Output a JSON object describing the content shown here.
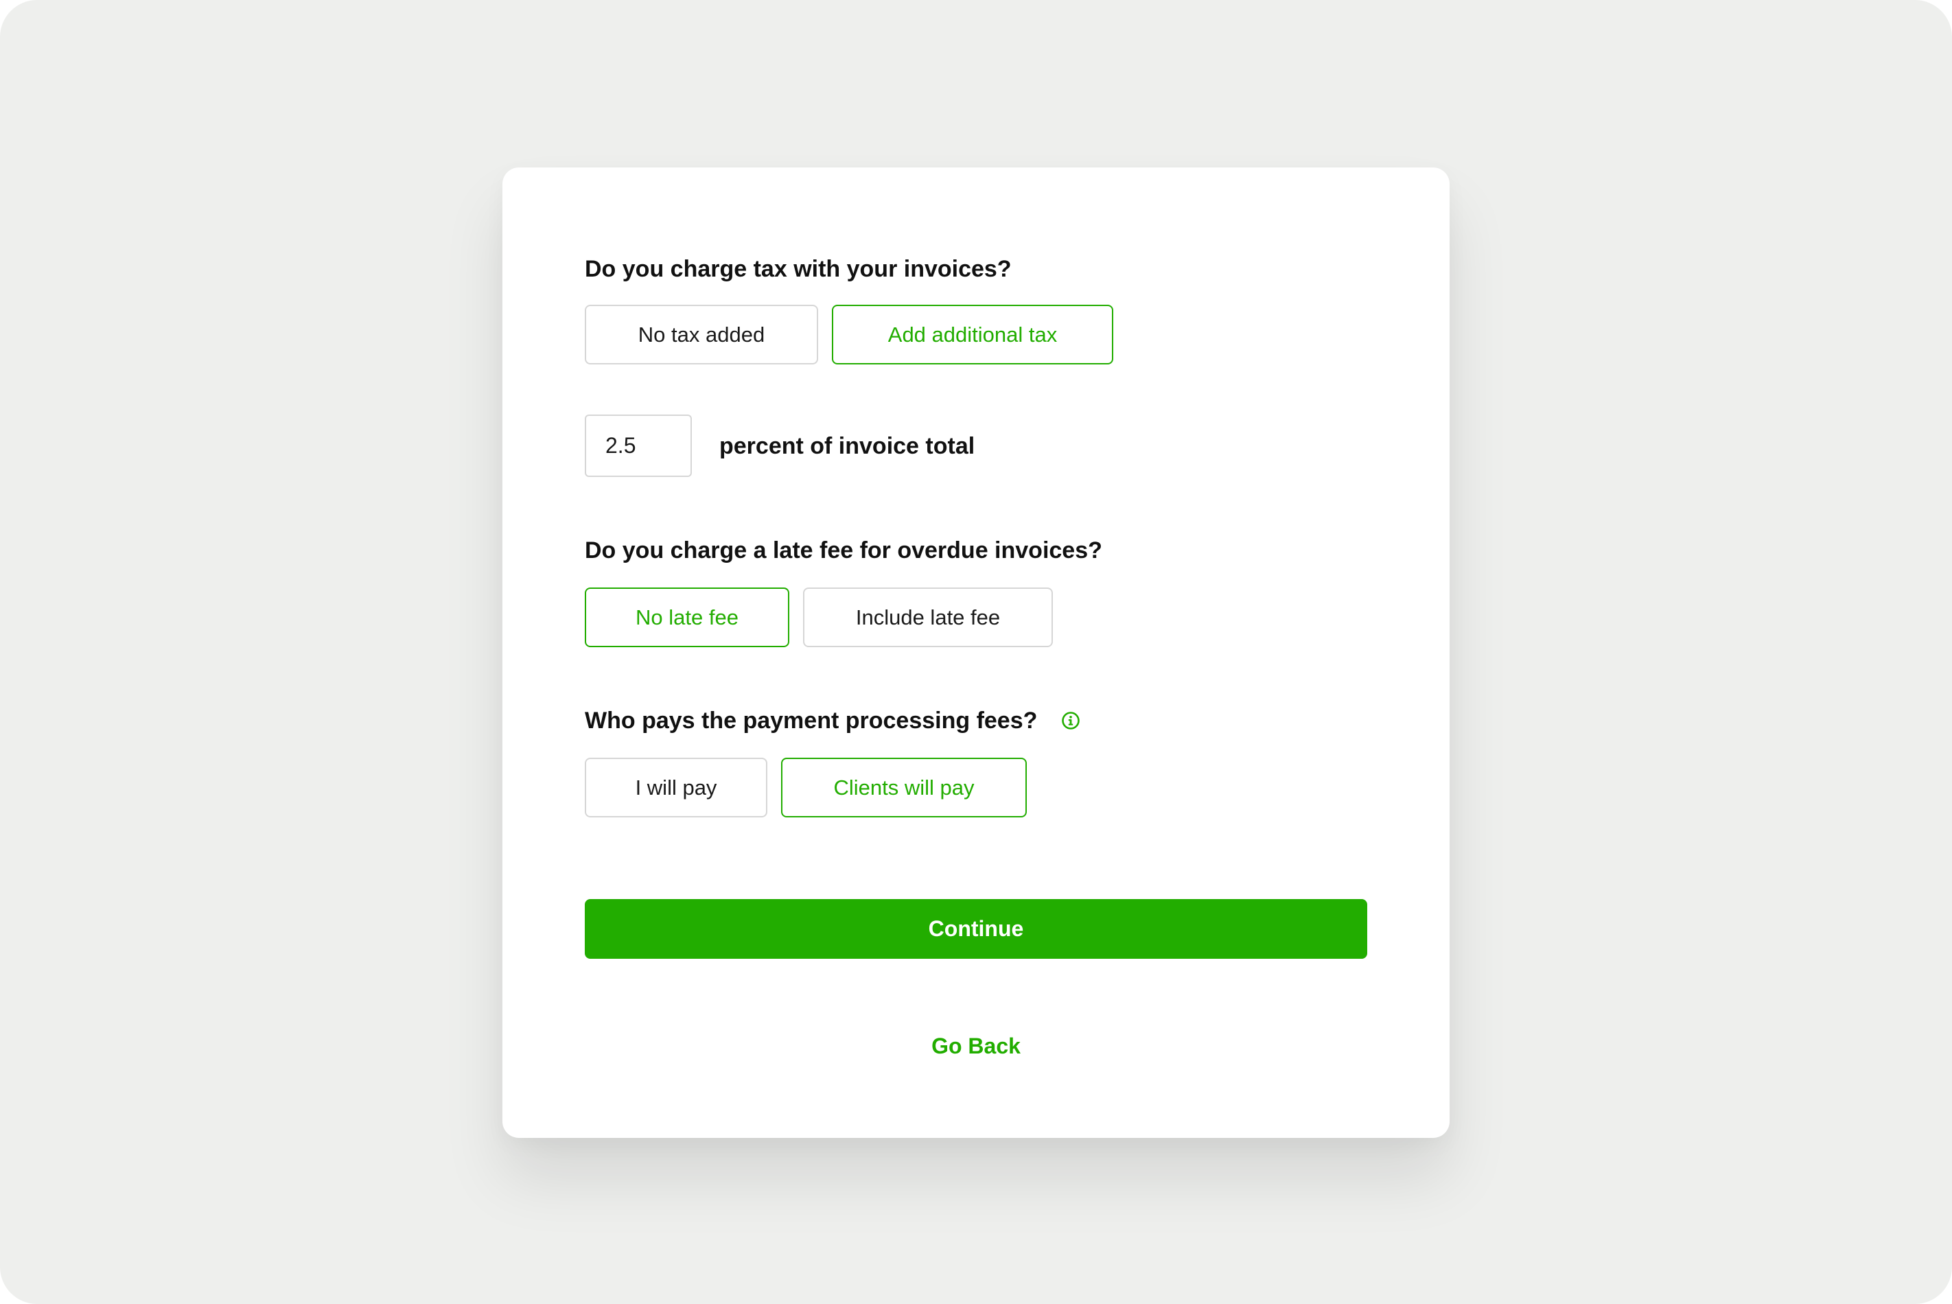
{
  "tax": {
    "question": "Do you charge tax with your invoices?",
    "options": [
      {
        "label": "No tax added",
        "selected": false
      },
      {
        "label": "Add additional tax",
        "selected": true
      }
    ],
    "percent_value": "2.5",
    "percent_label": "percent of invoice total"
  },
  "late_fee": {
    "question": "Do you charge a late fee for overdue invoices?",
    "options": [
      {
        "label": "No late fee",
        "selected": true
      },
      {
        "label": "Include late fee",
        "selected": false
      }
    ]
  },
  "processing": {
    "question": "Who pays the payment processing fees?",
    "info_icon": "info-circle-icon",
    "options": [
      {
        "label": "I will pay",
        "selected": false
      },
      {
        "label": "Clients will pay",
        "selected": true
      }
    ]
  },
  "actions": {
    "continue_label": "Continue",
    "go_back_label": "Go Back"
  },
  "colors": {
    "accent": "#22ad00",
    "background": "#eeefed",
    "card": "#ffffff",
    "border": "#d6d6d6"
  }
}
